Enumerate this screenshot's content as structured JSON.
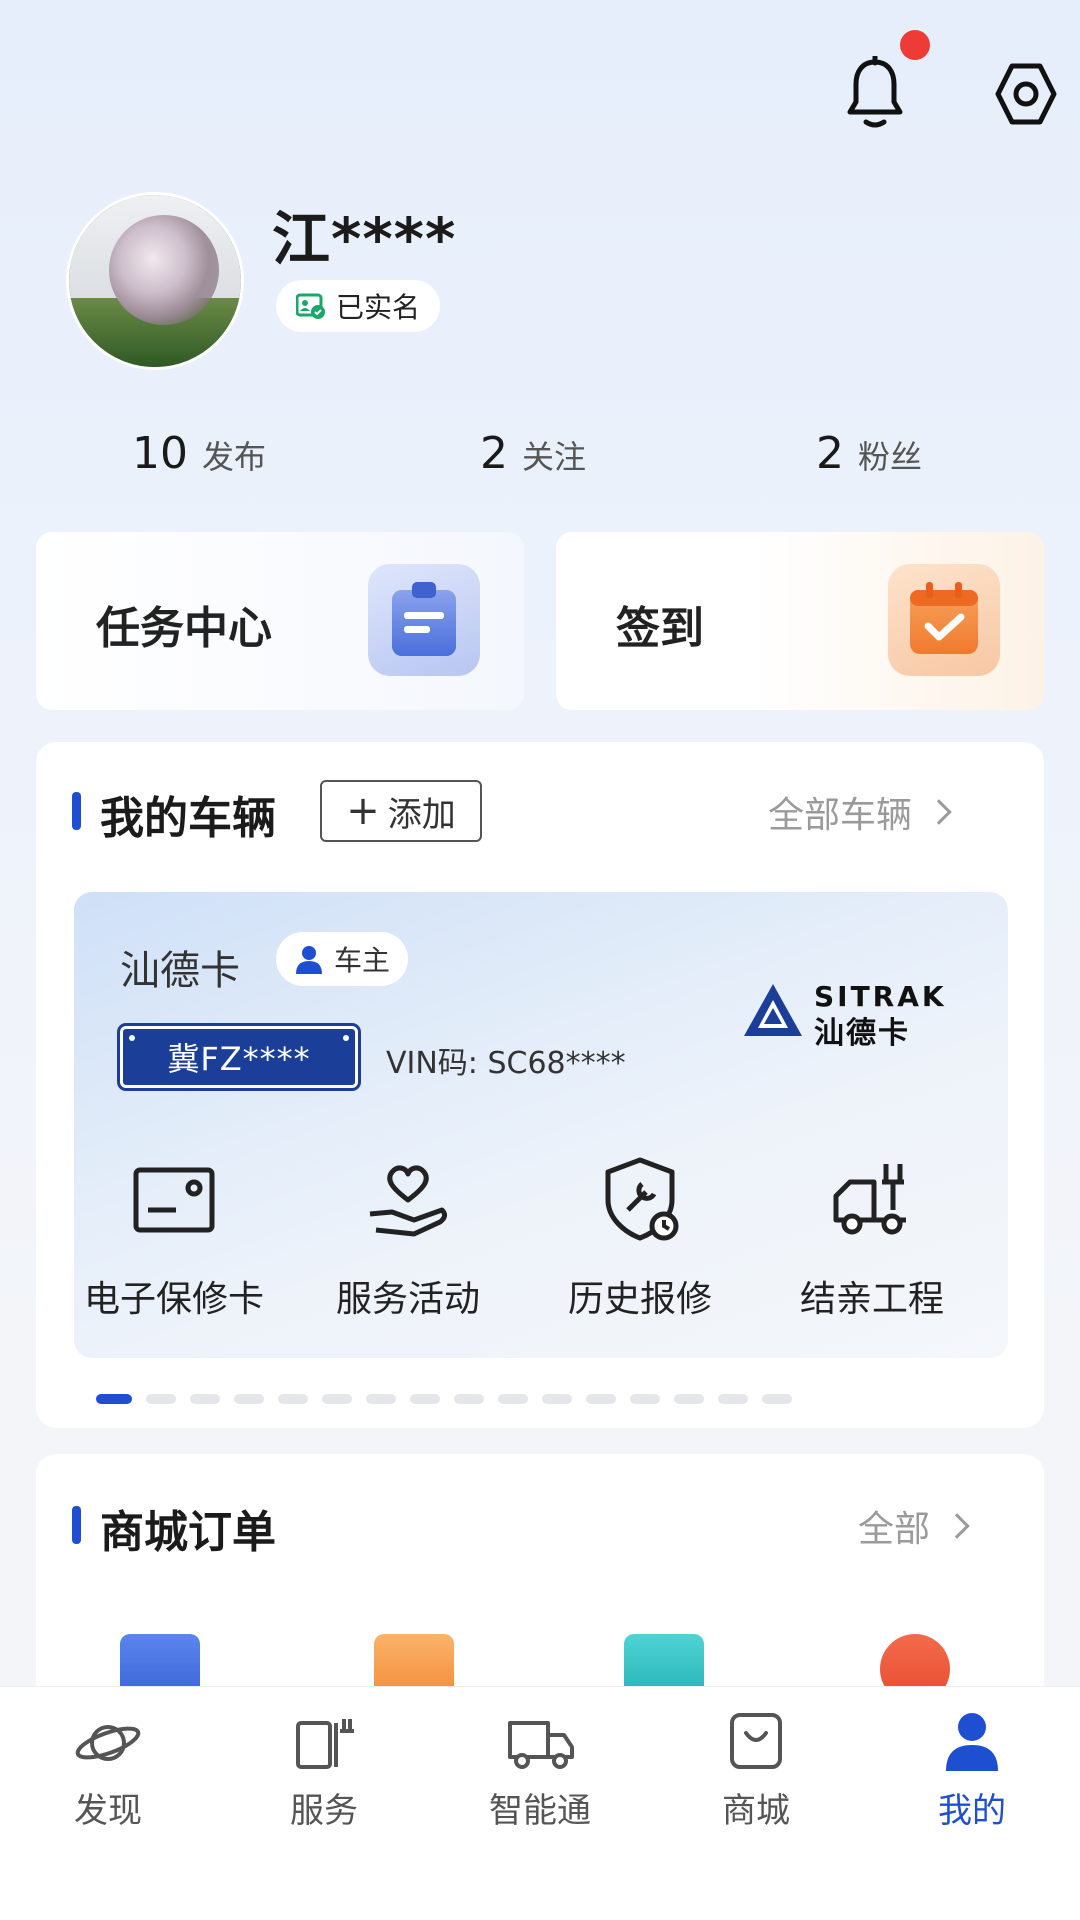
{
  "header": {
    "notification_badge": true,
    "accent": "#1f4fd1"
  },
  "profile": {
    "name": "江****",
    "verified_label": "已实名",
    "stats": [
      {
        "value": "10",
        "label": "发布"
      },
      {
        "value": "2",
        "label": "关注"
      },
      {
        "value": "2",
        "label": "粉丝"
      }
    ]
  },
  "quick_cards": [
    {
      "title": "任务中心",
      "icon": "clipboard-icon"
    },
    {
      "title": "签到",
      "icon": "calendar-check-icon"
    }
  ],
  "vehicles": {
    "title": "我的车辆",
    "add_label": "添加",
    "see_all_label": "全部车辆",
    "card": {
      "brand": "汕德卡",
      "role": "车主",
      "plate": "冀FZ****",
      "vin": "VIN码: SC68****",
      "logo_en": "SITRAK",
      "logo_cn": "汕德卡"
    },
    "functions": [
      {
        "label": "电子保修卡",
        "icon": "warranty-card-icon"
      },
      {
        "label": "服务活动",
        "icon": "heart-hand-icon"
      },
      {
        "label": "历史报修",
        "icon": "shield-wrench-icon"
      },
      {
        "label": "结亲工程",
        "icon": "truck-wrench-icon"
      }
    ],
    "pager_count": 16,
    "pager_active": 0
  },
  "orders": {
    "title": "商城订单",
    "see_all_label": "全部"
  },
  "bottom_nav": [
    {
      "label": "发现",
      "icon": "planet-icon"
    },
    {
      "label": "服务",
      "icon": "service-icon"
    },
    {
      "label": "智能通",
      "icon": "truck-icon"
    },
    {
      "label": "商城",
      "icon": "shopping-bag-icon"
    },
    {
      "label": "我的",
      "icon": "user-icon",
      "active": true
    }
  ]
}
